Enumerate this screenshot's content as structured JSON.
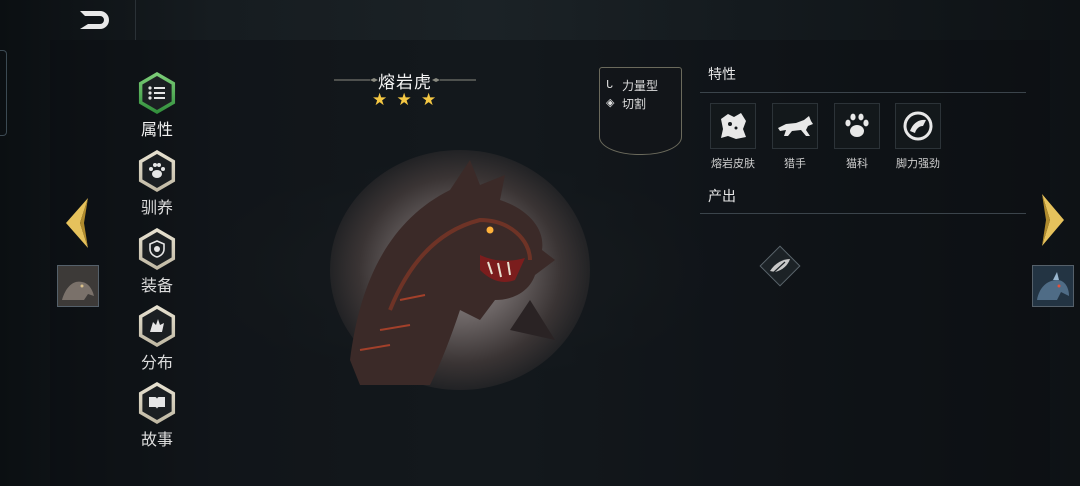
{
  "creature": {
    "name": "熔岩虎",
    "stars": [
      "★",
      "★",
      "★"
    ]
  },
  "type_badge": [
    {
      "icon": "strength-icon",
      "label": "力量型"
    },
    {
      "icon": "cutting-icon",
      "label": "切割"
    }
  ],
  "nav": [
    {
      "label": "属性",
      "icon": "list-icon",
      "active": true
    },
    {
      "label": "驯养",
      "icon": "paw-icon",
      "active": false
    },
    {
      "label": "装备",
      "icon": "shield-icon",
      "active": false
    },
    {
      "label": "分布",
      "icon": "creature-icon",
      "active": false
    },
    {
      "label": "故事",
      "icon": "book-icon",
      "active": false
    }
  ],
  "traits_section": {
    "title": "特性",
    "items": [
      {
        "label": "熔岩皮肤",
        "icon": "lava-skin-icon"
      },
      {
        "label": "猎手",
        "icon": "wolf-icon"
      },
      {
        "label": "猫科",
        "icon": "cat-paw-icon"
      },
      {
        "label": "脚力强劲",
        "icon": "strong-leg-icon"
      }
    ]
  },
  "output_section": {
    "title": "产出",
    "items": [
      {
        "icon": "feather-icon"
      }
    ]
  },
  "colors": {
    "accent_gold": "#f5c843",
    "active_green": "#3bb24a",
    "bg": "#0d1114"
  }
}
